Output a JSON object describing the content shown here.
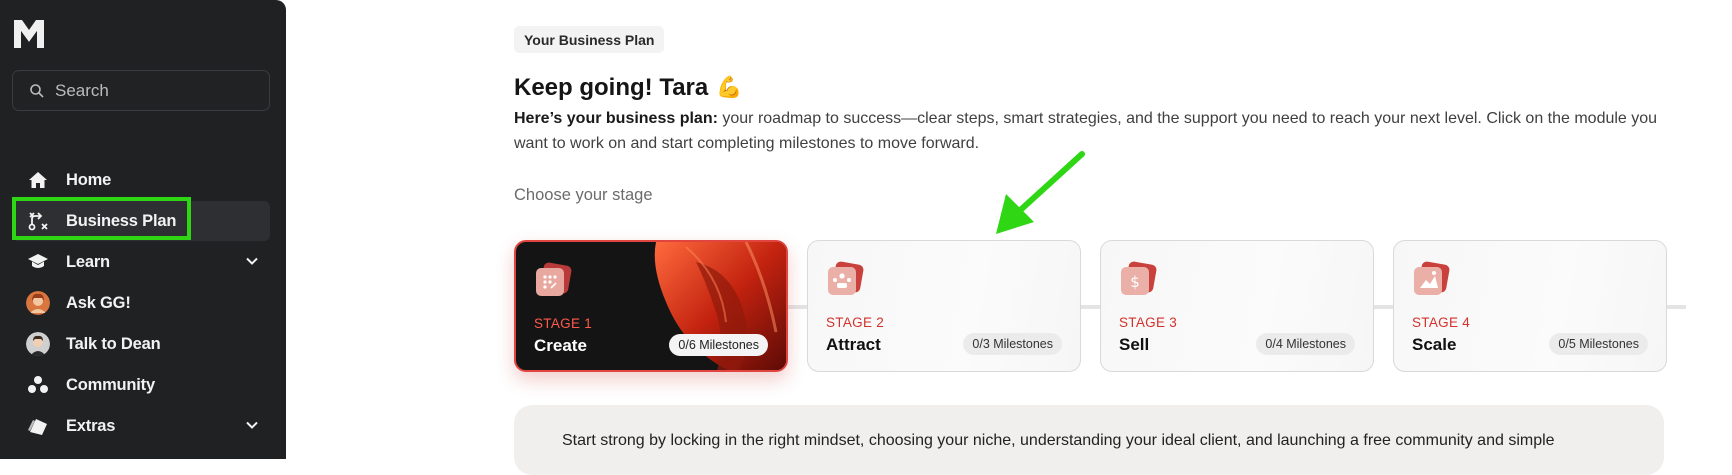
{
  "sidebar": {
    "search_placeholder": "Search",
    "items": [
      {
        "label": "Home",
        "icon": "home-icon"
      },
      {
        "label": "Business Plan",
        "icon": "route-icon",
        "active": true
      },
      {
        "label": "Learn",
        "icon": "graduation-cap-icon",
        "has_submenu": true
      },
      {
        "label": "Ask GG!",
        "icon": "avatar-gg"
      },
      {
        "label": "Talk to Dean",
        "icon": "avatar-dean"
      },
      {
        "label": "Community",
        "icon": "community-icon"
      },
      {
        "label": "Extras",
        "icon": "extras-icon",
        "has_submenu": true
      }
    ]
  },
  "main": {
    "section_pill": "Your Business Plan",
    "title": "Keep going! Tara",
    "title_emoji": "💪",
    "description_bold": "Here’s your business plan:",
    "description_rest": " your roadmap to success—clear steps, smart strategies, and the support you need to reach your next level. Click on the module you want to work on and start completing milestones to move forward.",
    "choose_label": "Choose your stage",
    "stages": [
      {
        "number": "STAGE 1",
        "name": "Create",
        "milestones": "0/6 Milestones",
        "active": true
      },
      {
        "number": "STAGE 2",
        "name": "Attract",
        "milestones": "0/3 Milestones"
      },
      {
        "number": "STAGE 3",
        "name": "Sell",
        "milestones": "0/4 Milestones"
      },
      {
        "number": "STAGE 4",
        "name": "Scale",
        "milestones": "0/5 Milestones"
      }
    ],
    "bottom_text": "Start strong by locking in the right mindset, choosing your niche, understanding your ideal client, and launching a free community and simple"
  },
  "colors": {
    "sidebar_bg": "#1f2123",
    "accent_red": "#d2322c",
    "highlight_green": "#2ed614"
  }
}
